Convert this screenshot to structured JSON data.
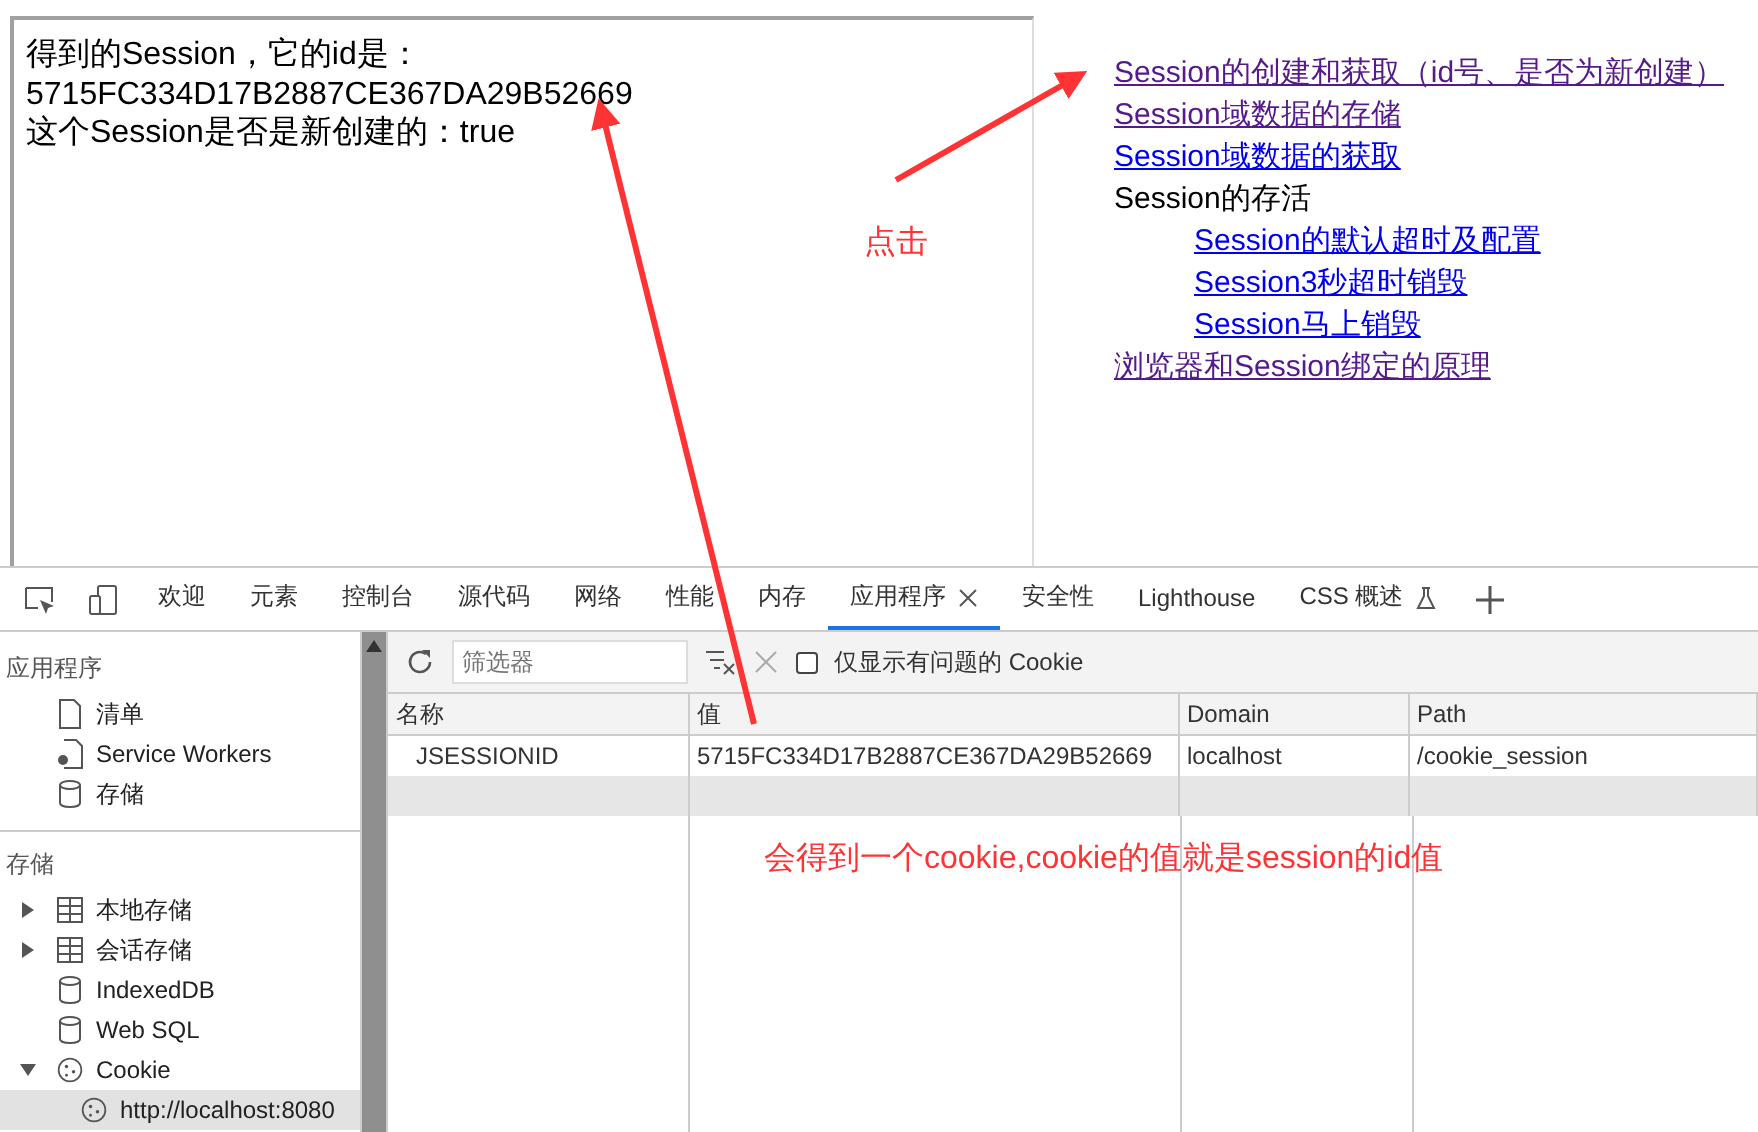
{
  "page": {
    "lines": [
      "得到的Session，它的id是：",
      "5715FC334D17B2887CE367DA29B52669",
      "这个Session是否是新创建的：true"
    ]
  },
  "links": [
    {
      "kind": "link",
      "text": "Session的创建和获取（id号、是否为新创建）",
      "visited": true
    },
    {
      "kind": "link",
      "text": "Session域数据的存储",
      "visited": true
    },
    {
      "kind": "link",
      "text": "Session域数据的获取",
      "visited": false
    },
    {
      "kind": "heading",
      "text": "Session的存活",
      "children": [
        {
          "kind": "link",
          "text": "Session的默认超时及配置",
          "visited": false
        },
        {
          "kind": "link",
          "text": "Session3秒超时销毁",
          "visited": false
        },
        {
          "kind": "link",
          "text": "Session马上销毁",
          "visited": false
        }
      ]
    },
    {
      "kind": "link",
      "text": "浏览器和Session绑定的原理",
      "visited": true
    }
  ],
  "annotations": {
    "click_note": "点击",
    "cookie_note": "会得到一个cookie,cookie的值就是session的id值"
  },
  "devtools": {
    "tabs": [
      {
        "label": "欢迎",
        "selected": false
      },
      {
        "label": "元素",
        "selected": false
      },
      {
        "label": "控制台",
        "selected": false
      },
      {
        "label": "源代码",
        "selected": false
      },
      {
        "label": "网络",
        "selected": false
      },
      {
        "label": "性能",
        "selected": false
      },
      {
        "label": "内存",
        "selected": false
      },
      {
        "label": "应用程序",
        "selected": true
      },
      {
        "label": "安全性",
        "selected": false
      },
      {
        "label": "Lighthouse",
        "selected": false
      },
      {
        "label": "CSS 概述",
        "selected": false,
        "experimental": true
      }
    ],
    "sidebar": [
      {
        "title": "应用程序",
        "items": [
          {
            "kind": "file",
            "label": "清单"
          },
          {
            "kind": "worker",
            "label": "Service Workers"
          },
          {
            "kind": "db",
            "label": "存储"
          }
        ]
      },
      {
        "title": "存储",
        "items": [
          {
            "kind": "table",
            "label": "本地存储",
            "expanded": false
          },
          {
            "kind": "table",
            "label": "会话存储",
            "expanded": false
          },
          {
            "kind": "db",
            "label": "IndexedDB"
          },
          {
            "kind": "db",
            "label": "Web SQL"
          },
          {
            "kind": "cookie",
            "label": "Cookie",
            "expanded": true,
            "children": [
              {
                "kind": "cookie",
                "label": "http://localhost:8080",
                "selected": true
              }
            ]
          }
        ]
      }
    ],
    "toolbar": {
      "filter": {
        "placeholder": "筛选器"
      },
      "issues_only": {
        "label": "仅显示有问题的 Cookie",
        "checked": false
      }
    },
    "table": {
      "columns": [
        "名称",
        "值",
        "Domain",
        "Path"
      ],
      "rows": [
        [
          "JSESSIONID",
          "5715FC334D17B2887CE367DA29B52669",
          "localhost",
          "/cookie_session"
        ]
      ]
    }
  }
}
